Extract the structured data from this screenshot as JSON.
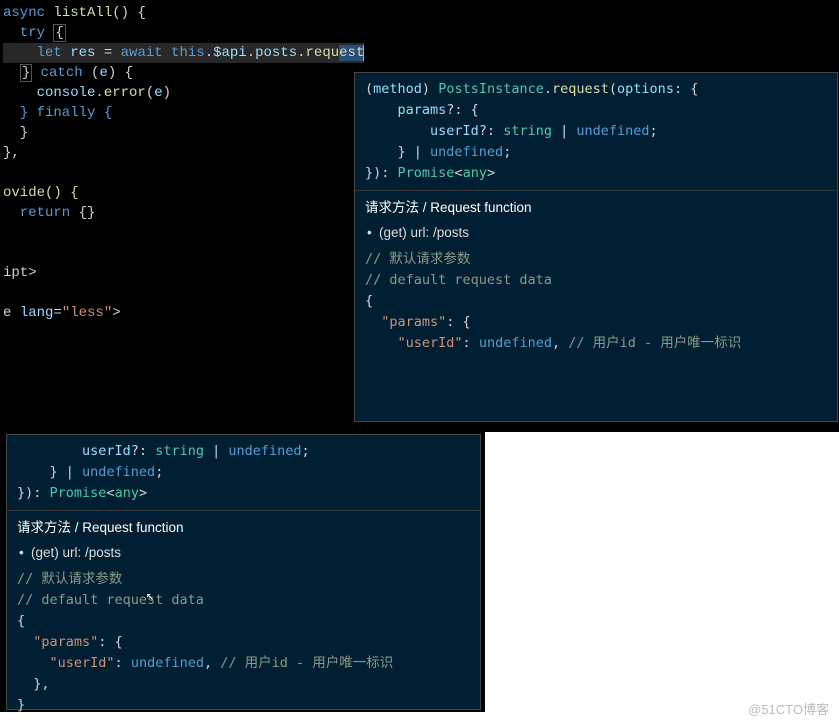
{
  "code": {
    "l1a": "async ",
    "l1b": "listAll",
    "l1c": "() {",
    "l2a": "  try ",
    "l2b": "{",
    "l3a": "    let ",
    "l3b": "res",
    "l3c": " = ",
    "l3d": "await ",
    "l3e": "this",
    "l3f": ".$api.",
    "l3g": "posts",
    "l3h": ".",
    "l3i": "requ",
    "l3j": "est",
    "l4a": "  ",
    "l4b": "}",
    "l4c": " catch ",
    "l4d": "(",
    "l4e": "e",
    "l4f": ") {",
    "l5a": "    console.",
    "l5b": "error",
    "l5c": "(",
    "l5d": "e",
    "l5e": ")",
    "l6": "  } finally {",
    "l7": "  }",
    "l8": "},",
    "l10": "ovide() {",
    "l11a": "  return ",
    "l11b": "{}",
    "l13": "ipt>",
    "l15a": "e ",
    "l15b": "lang",
    "l15c": "=",
    "l15d": "\"less\"",
    "l15e": ">"
  },
  "tip1": {
    "s1a": "(",
    "s1b": "method",
    "s1c": ") ",
    "s1d": "PostsInstance",
    "s1e": ".",
    "s1f": "request",
    "s1g": "(",
    "s1h": "options",
    "s1i": ": {",
    "s2a": "    params",
    "s2b": "?: {",
    "s3a": "        userId",
    "s3b": "?: ",
    "s3c": "string",
    "s3d": " | ",
    "s3e": "undefined",
    "s3f": ";",
    "s4a": "    } | ",
    "s4b": "undefined",
    "s4c": ";",
    "s5a": "}): ",
    "s5b": "Promise",
    "s5c": "<",
    "s5d": "any",
    "s5e": ">",
    "doc_title": "请求方法 / Request function",
    "doc_bullet": "(get) url: /posts",
    "c1": "// 默认请求参数",
    "c2": "// default request data",
    "c3": "{",
    "c4a": "  \"params\"",
    "c4b": ": {",
    "c5a": "    \"userId\"",
    "c5b": ": ",
    "c5c": "undefined",
    "c5d": ", ",
    "c5e": "// 用户id - 用户唯一标识"
  },
  "tip2": {
    "s3a": "        userId",
    "s3b": "?: ",
    "s3c": "string",
    "s3d": " | ",
    "s3e": "undefined",
    "s3f": ";",
    "s4a": "    } | ",
    "s4b": "undefined",
    "s4c": ";",
    "s5a": "}): ",
    "s5b": "Promise",
    "s5c": "<",
    "s5d": "any",
    "s5e": ">",
    "doc_title": "请求方法 / Request function",
    "doc_bullet": "(get) url: /posts",
    "c1": "// 默认请求参<span></span>数",
    "c2": "// default request data",
    "c3": "{",
    "c4a": "  \"params\"",
    "c4b": ": {",
    "c5a": "    \"userId\"",
    "c5b": ": ",
    "c5c": "undefined",
    "c5d": ", ",
    "c5e": "// 用户id - 用户唯一标识",
    "c6": "  },",
    "c7": "}"
  },
  "watermark": "@51CTO博客"
}
